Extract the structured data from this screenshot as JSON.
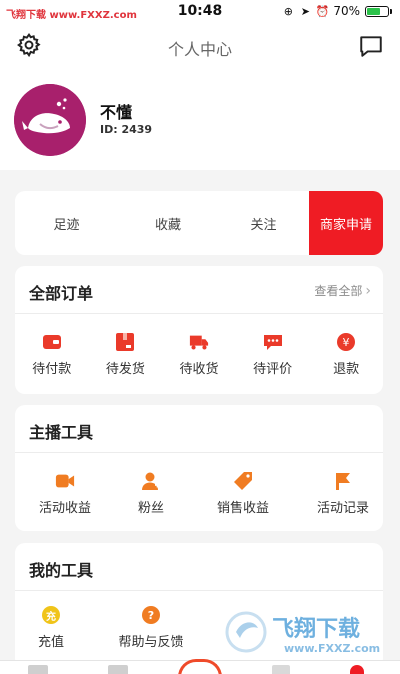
{
  "status": {
    "left_text": "飞翔下载 www.FXXZ.com",
    "time": "10:48",
    "battery": "70%",
    "battery_level": 0.7
  },
  "nav": {
    "title": "个人中心",
    "settings_icon": "gear-icon",
    "message_icon": "chat-bubble-icon"
  },
  "profile": {
    "name": "不懂",
    "id": "ID: 2439",
    "avatar_icon": "whale-icon",
    "avatar_color": "#a8206c"
  },
  "tabs": [
    {
      "label": "足迹"
    },
    {
      "label": "收藏"
    },
    {
      "label": "关注"
    },
    {
      "label": "商家申请"
    }
  ],
  "orders": {
    "title": "全部订单",
    "view_all": "查看全部",
    "items": [
      {
        "label": "待付款",
        "icon": "wallet-icon"
      },
      {
        "label": "待发货",
        "icon": "package-icon"
      },
      {
        "label": "待收货",
        "icon": "truck-icon"
      },
      {
        "label": "待评价",
        "icon": "comment-icon"
      },
      {
        "label": "退款",
        "icon": "refund-icon"
      }
    ]
  },
  "streamer_tools": {
    "title": "主播工具",
    "items": [
      {
        "label": "活动收益",
        "icon": "video-icon"
      },
      {
        "label": "粉丝",
        "icon": "fans-icon"
      },
      {
        "label": "销售收益",
        "icon": "tag-icon"
      },
      {
        "label": "活动记录",
        "icon": "flag-icon"
      }
    ]
  },
  "my_tools": {
    "title": "我的工具",
    "items": [
      {
        "label": "充值",
        "icon": "recharge-icon",
        "badge": "充"
      },
      {
        "label": "帮助与反馈",
        "icon": "help-icon",
        "badge": "?"
      }
    ]
  },
  "watermark": {
    "text": "飞翔下载",
    "url": "www.FXXZ.com"
  },
  "colors": {
    "accent": "#ef1c24",
    "icon_red": "#ea3a2a",
    "icon_orange": "#f07c22",
    "recharge_yellow": "#f0c419"
  }
}
